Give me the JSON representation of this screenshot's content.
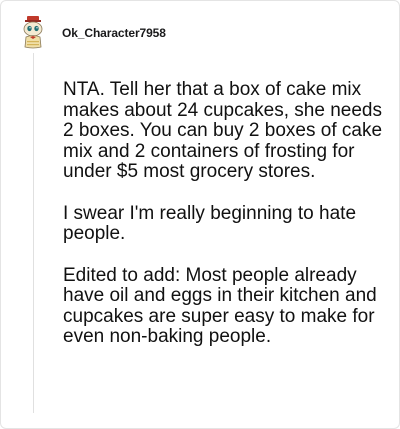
{
  "comment": {
    "username": "Ok_Character7958",
    "avatar_icon": "snoo-avatar-icon",
    "paragraphs": [
      "NTA. Tell her that a box of cake mix makes about 24 cupcakes, she needs 2 boxes. You can buy 2 boxes of cake mix and 2 containers of frosting for under $5 most grocery stores.",
      "I swear I'm really beginning to hate people.",
      "Edited to add: Most people already have oil and eggs in their kitchen and cupcakes are super easy to make for even non-baking people."
    ]
  }
}
